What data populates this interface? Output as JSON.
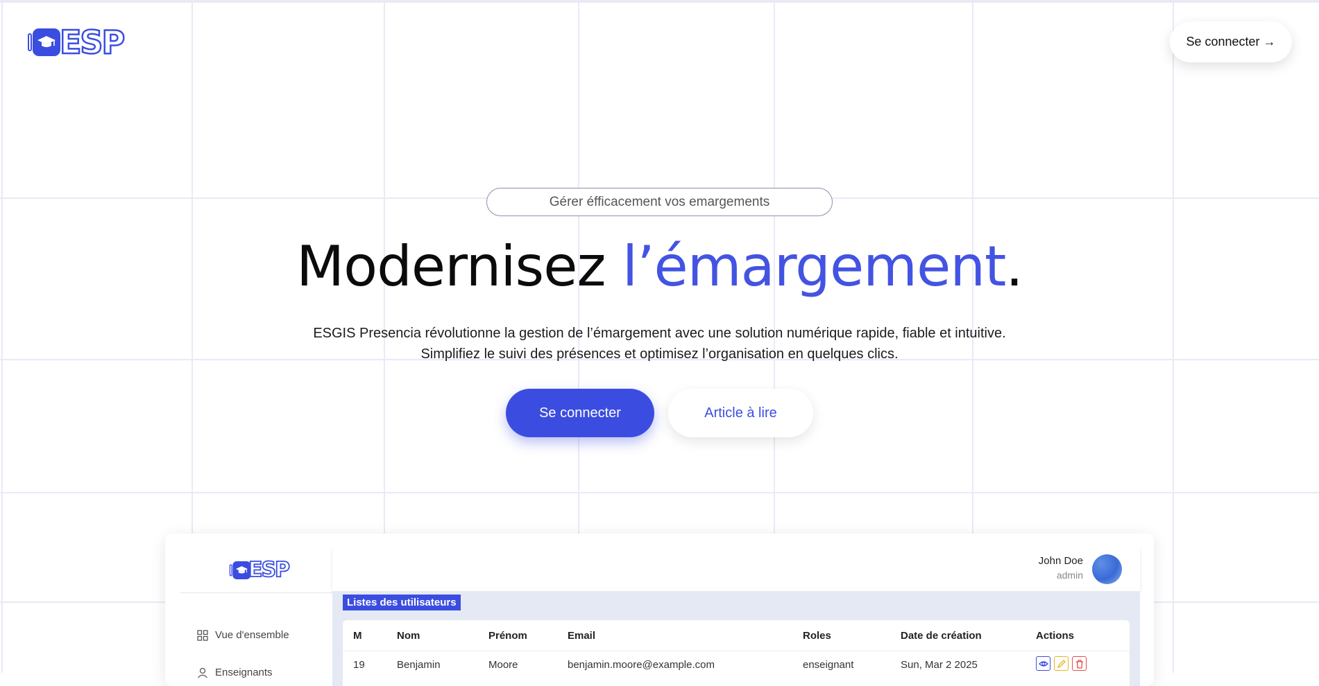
{
  "header": {
    "logo_text": "ESP",
    "login_label": "Se connecter →"
  },
  "hero": {
    "tagline": "Gérer éfficacement vos emargements",
    "title_main": "Modernisez ",
    "title_accent": "l’émargement",
    "title_end": ".",
    "description_line1": "ESGIS Presencia révolutionne la gestion de l’émargement avec une solution numérique rapide, fiable et intuitive.",
    "description_line2": "Simplifiez le suivi des présences et optimisez l’organisation en quelques clics.",
    "primary_button": "Se connecter",
    "secondary_button": "Article à lire"
  },
  "preview": {
    "logo_text": "ESP",
    "nav": [
      {
        "label": "Vue d'ensemble",
        "icon": "grid-icon"
      },
      {
        "label": "Enseignants",
        "icon": "user-icon"
      }
    ],
    "user": {
      "name": "John Doe",
      "role": "admin"
    },
    "section_title": "Listes des utilisateurs",
    "columns": [
      "M",
      "Nom",
      "Prénom",
      "Email",
      "Roles",
      "Date de création",
      "Actions"
    ],
    "rows": [
      {
        "id": "19",
        "nom": "Benjamin",
        "prenom": "Moore",
        "email": "benjamin.moore@example.com",
        "role": "enseignant",
        "date": "Sun, Mar 2 2025"
      }
    ],
    "action_icons": [
      "eye-icon",
      "pencil-icon",
      "trash-icon"
    ]
  },
  "colors": {
    "accent": "#3b4de0",
    "title_accent": "#4353e2",
    "edit": "#e6b422",
    "delete": "#e34b4b"
  }
}
